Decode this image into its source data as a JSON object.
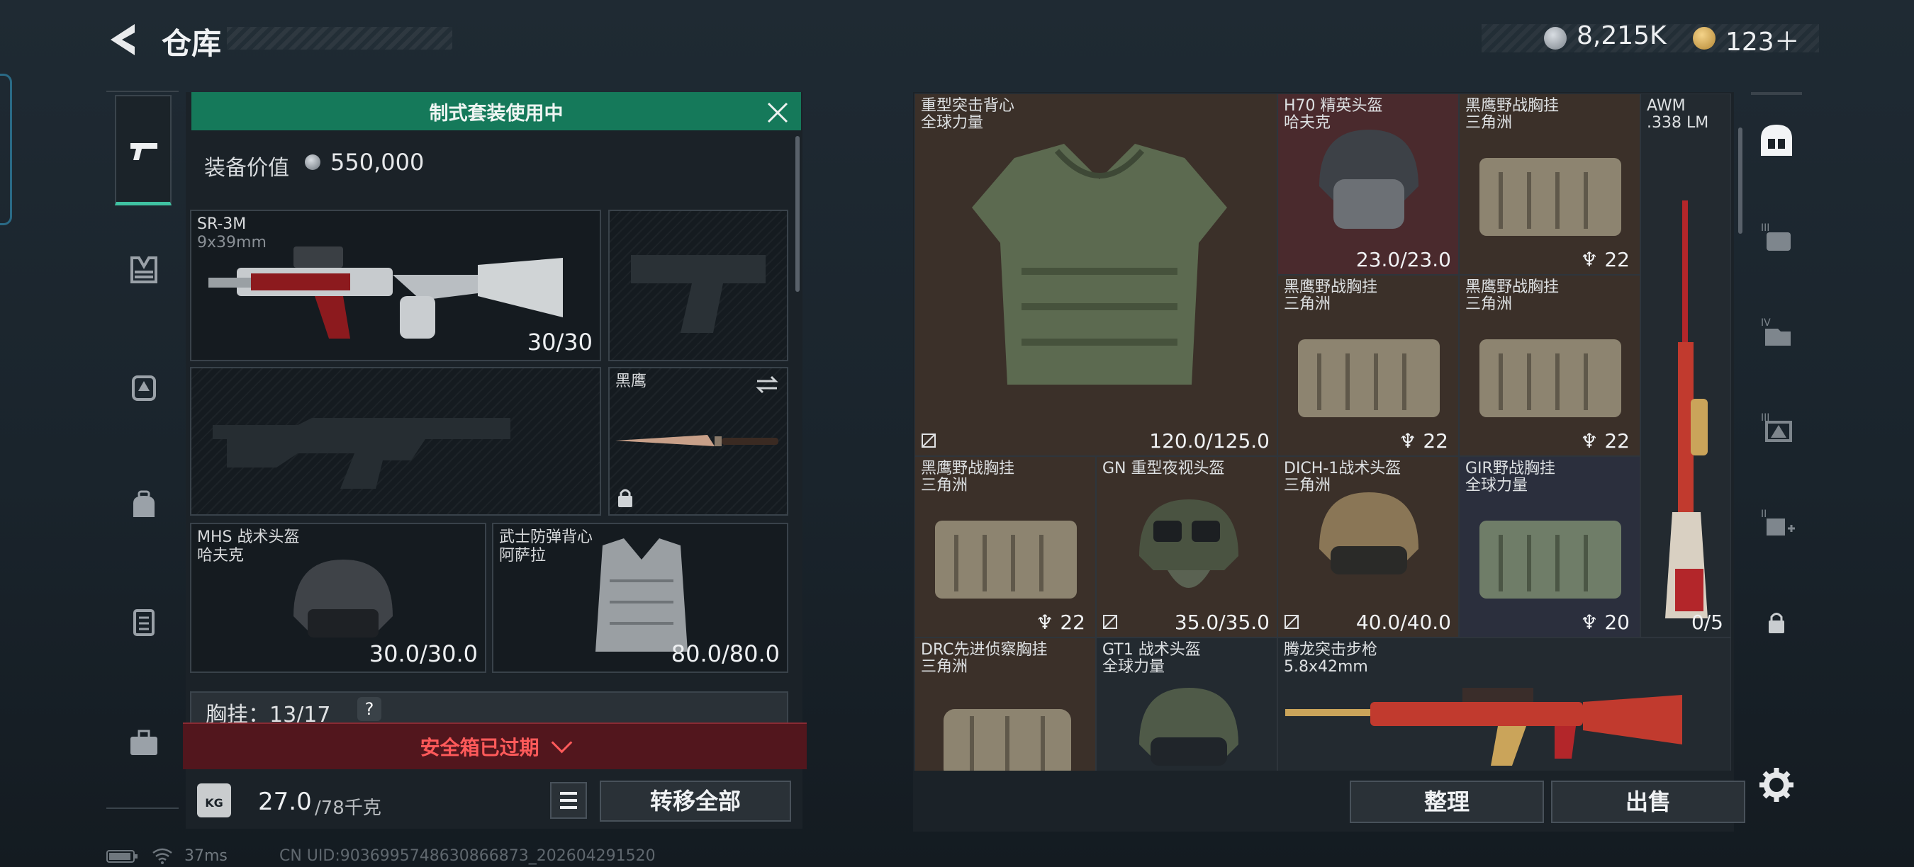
{
  "header": {
    "title": "仓库"
  },
  "currency": {
    "silver": "8,215K",
    "gold": "123＋"
  },
  "left_panel": {
    "banner": "制式套装使用中",
    "value_label": "装备价值",
    "value": "550,000",
    "slots": [
      {
        "name": "SR-3M",
        "sub": "9x39mm",
        "value": "30/30"
      },
      {
        "name": "黑鹰",
        "sub": "",
        "value": ""
      },
      {
        "name": "MHS 战术头盔",
        "sub": "哈夫克",
        "value": "30.0/30.0"
      },
      {
        "name": "武士防弹背心",
        "sub": "阿萨拉",
        "value": "80.0/80.0"
      }
    ],
    "chest_label": "胸挂：13/17",
    "chest_help": "?",
    "safe_box": "安全箱已过期",
    "weight": "27.0",
    "weight_unit": "/78千克",
    "transfer_all": "转移全部"
  },
  "grid_items": [
    {
      "name": "重型突击背心",
      "sub": "全球力量",
      "value": "120.0/125.0",
      "count": ""
    },
    {
      "name": "H70 精英头盔",
      "sub": "哈夫克",
      "value": "23.0/23.0",
      "count": ""
    },
    {
      "name": "黑鹰野战胸挂",
      "sub": "三角洲",
      "value": "",
      "count": "22"
    },
    {
      "name": "AWM",
      "sub": ".338 LM",
      "value": "0/5",
      "count": ""
    },
    {
      "name": "黑鹰野战胸挂",
      "sub": "三角洲",
      "value": "",
      "count": "22"
    },
    {
      "name": "黑鹰野战胸挂",
      "sub": "三角洲",
      "value": "",
      "count": "22"
    },
    {
      "name": "黑鹰野战胸挂",
      "sub": "三角洲",
      "value": "",
      "count": "22"
    },
    {
      "name": "GN 重型夜视头盔",
      "sub": "",
      "value": "35.0/35.0",
      "count": ""
    },
    {
      "name": "DICH-1战术头盔",
      "sub": "三角洲",
      "value": "40.0/40.0",
      "count": ""
    },
    {
      "name": "GIR野战胸挂",
      "sub": "全球力量",
      "value": "",
      "count": "20"
    },
    {
      "name": "DRC先进侦察胸挂",
      "sub": "三角洲",
      "value": "",
      "count": ""
    },
    {
      "name": "GT1 战术头盔",
      "sub": "全球力量",
      "value": "",
      "count": ""
    },
    {
      "name": "腾龙突击步枪",
      "sub": "5.8x42mm",
      "value": "",
      "count": ""
    }
  ],
  "actions": {
    "organize": "整理",
    "sell": "出售"
  },
  "status_bar": {
    "ping": "37ms",
    "uid": "CN UID:9036995748630866873_202604291520"
  },
  "colors": {
    "accent_green": "#15795a",
    "alert_red": "#ff5a5a",
    "rarity_brown": "#3b3029",
    "rarity_red": "#4a2a2d",
    "rarity_navy": "#2b2f3d"
  }
}
